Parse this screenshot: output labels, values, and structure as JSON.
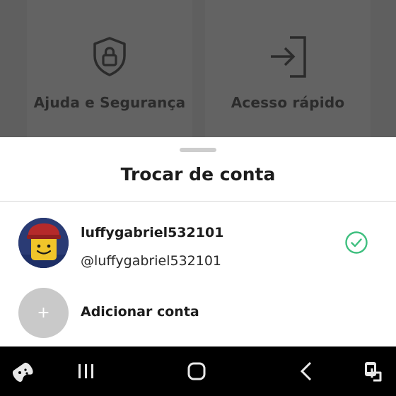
{
  "background": {
    "cards": [
      {
        "label": "Ajuda e Segurança",
        "icon": "shield-lock-icon"
      },
      {
        "label": "Acesso rápido",
        "icon": "login-arrow-icon"
      }
    ]
  },
  "sheet": {
    "title": "Trocar de conta",
    "account": {
      "display_name": "luffygabriel532101",
      "username": "@luffygabriel532101",
      "selected": true,
      "avatar_icon": "roblox-avatar"
    },
    "add_account": {
      "label": "Adicionar conta",
      "icon": "+"
    }
  },
  "navbar": {
    "buttons": [
      "game-launcher-icon",
      "recent-apps-icon",
      "home-icon",
      "back-icon",
      "accessibility-icon"
    ]
  },
  "colors": {
    "check_green": "#3fbf7f",
    "sheet_bg": "#ffffff",
    "dim_bg": "#5f5f5f",
    "avatar_placeholder": "#c9c9c9"
  }
}
